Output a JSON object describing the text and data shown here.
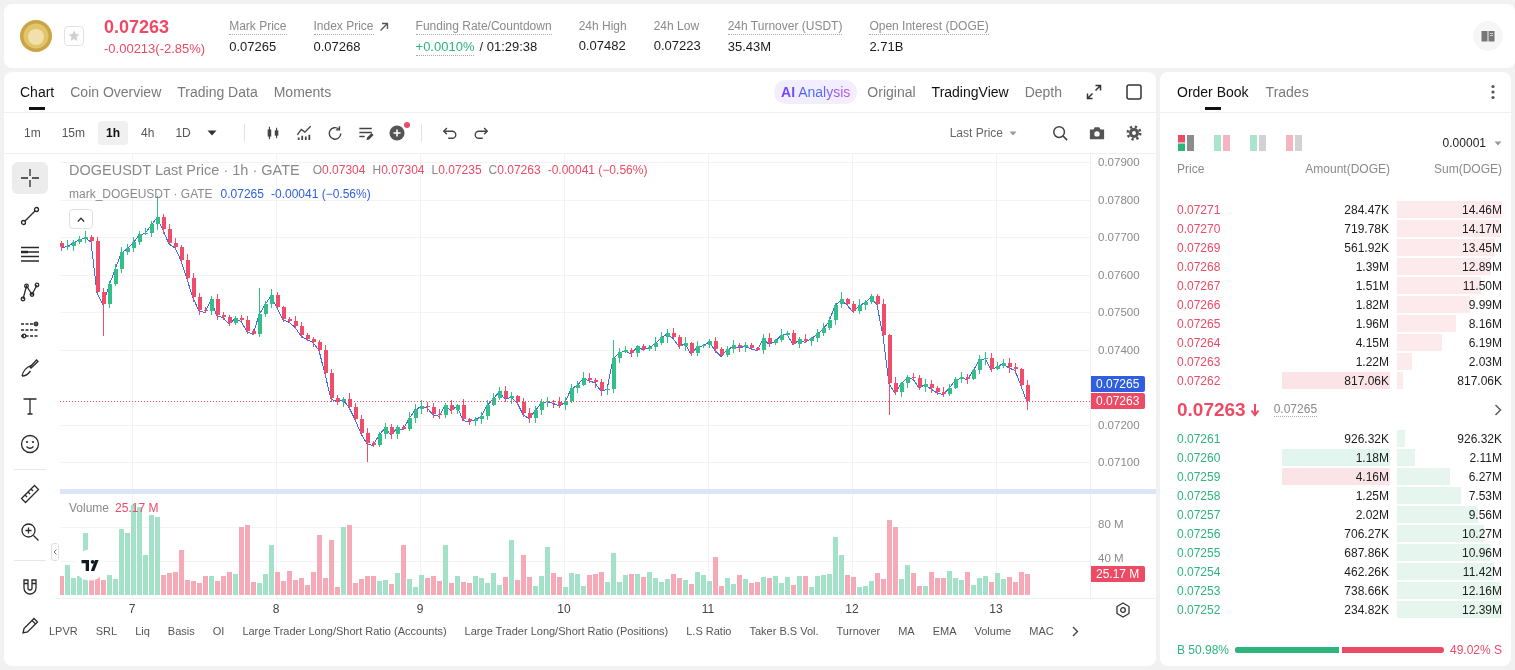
{
  "ticker": {
    "favorite": false,
    "price": "0.07263",
    "change": "-0.00213(-2.85%)",
    "rising": false
  },
  "stats": [
    {
      "kind": "plain",
      "label": "Mark Price",
      "value": "0.07265",
      "has_tooltip": true
    },
    {
      "kind": "link",
      "label": "Index Price",
      "value": "0.07268",
      "has_tooltip": true
    },
    {
      "kind": "funding",
      "label": "Funding Rate/Countdown",
      "value": "+0.0010%",
      "rising": true,
      "countdown": "/ 01:29:38",
      "has_tooltip": true
    },
    {
      "kind": "plain",
      "label": "24h High",
      "value": "0.07482",
      "has_tooltip": false
    },
    {
      "kind": "plain",
      "label": "24h Low",
      "value": "0.07223",
      "has_tooltip": false
    },
    {
      "kind": "plain",
      "label": "24h Turnover (USDT)",
      "value": "35.43M",
      "has_tooltip": true
    },
    {
      "kind": "plain",
      "label": "Open Interest (DOGE)",
      "value": "2.71B",
      "has_tooltip": true
    }
  ],
  "chart_tabs": [
    {
      "label": "Chart",
      "selected": true
    },
    {
      "label": "Coin Overview",
      "selected": false
    },
    {
      "label": "Trading Data",
      "selected": false
    },
    {
      "label": "Moments",
      "selected": false
    }
  ],
  "view_modes": [
    {
      "kind": "ai",
      "label": "**AI** Analysis",
      "selected": false
    },
    {
      "kind": "mode",
      "label": "Original",
      "selected": false
    },
    {
      "kind": "mode",
      "label": "TradingView",
      "selected": true
    },
    {
      "kind": "mode",
      "label": "Depth",
      "selected": false
    }
  ],
  "intervals": [
    {
      "label": "1m",
      "selected": false
    },
    {
      "label": "15m",
      "selected": false
    },
    {
      "label": "1h",
      "selected": true
    },
    {
      "label": "4h",
      "selected": false
    },
    {
      "label": "1D",
      "selected": false
    }
  ],
  "price_source": "Last Price",
  "drawing_tools": [
    {
      "selected": true
    },
    {
      "selected": false
    },
    {
      "selected": false
    },
    {
      "selected": false
    },
    {
      "selected": false
    },
    {
      "selected": false
    },
    {
      "selected": false
    },
    {
      "selected": false
    },
    {
      "selected": false
    },
    {
      "selected": false
    },
    {
      "selected": false
    },
    {
      "selected": false
    }
  ],
  "legend": {
    "title": "DOGEUSDT Last Price · 1h · GATE",
    "ohlc": [
      {
        "key": "O",
        "value": "0.07304"
      },
      {
        "key": "H",
        "value": "0.07304"
      },
      {
        "key": "L",
        "value": "0.07235"
      },
      {
        "key": "C",
        "value": "0.07263"
      }
    ],
    "change": "-0.00041 (−0.56%)",
    "rising": false
  },
  "mark_legend": {
    "title": "mark_DOGEUSDT · GATE",
    "value": "0.07265",
    "change": "-0.00041 (−0.56%)"
  },
  "price_axis": {
    "ticks": [
      "0.07900",
      "0.07800",
      "0.07700",
      "0.07600",
      "0.07500",
      "0.07400",
      "0.07200",
      "0.07100"
    ],
    "mark_label": "0.07265",
    "last_label": "0.07263"
  },
  "volume": {
    "title": "Volume",
    "value": "25.17 M",
    "ticks": [
      "80 M",
      "40 M"
    ],
    "last_label": "25.17 M"
  },
  "time_axis": [
    "7",
    "8",
    "9",
    "10",
    "11",
    "12",
    "13"
  ],
  "indicators": [
    "LPVR",
    "SRL",
    "Liq",
    "Basis",
    "OI",
    "Large Trader Long/Short Ratio (Accounts)",
    "Large Trader Long/Short Ratio (Positions)",
    "L.S Ratio",
    "Taker B.S Vol.",
    "Turnover",
    "MA",
    "EMA",
    "Volume",
    "MAC"
  ],
  "order_book": {
    "tabs": [
      {
        "label": "Order Book",
        "selected": true
      },
      {
        "label": "Trades",
        "selected": false
      }
    ],
    "layouts": [
      {
        "selected": true
      },
      {
        "selected": false
      },
      {
        "selected": false
      },
      {
        "selected": false
      }
    ],
    "precision": "0.00001",
    "columns": [
      "Price",
      "Amount(DOGE)",
      "Sum(DOGE)"
    ],
    "asks": [
      {
        "price": "0.07271",
        "amount": "284.47K",
        "sum": "14.46M"
      },
      {
        "price": "0.07270",
        "amount": "719.78K",
        "sum": "14.17M"
      },
      {
        "price": "0.07269",
        "amount": "561.92K",
        "sum": "13.45M"
      },
      {
        "price": "0.07268",
        "amount": "1.39M",
        "sum": "12.89M"
      },
      {
        "price": "0.07267",
        "amount": "1.51M",
        "sum": "11.50M"
      },
      {
        "price": "0.07266",
        "amount": "1.82M",
        "sum": "9.99M"
      },
      {
        "price": "0.07265",
        "amount": "1.96M",
        "sum": "8.16M"
      },
      {
        "price": "0.07264",
        "amount": "4.15M",
        "sum": "6.19M"
      },
      {
        "price": "0.07263",
        "amount": "1.22M",
        "sum": "2.03M"
      },
      {
        "price": "0.07262",
        "amount": "817.06K",
        "sum": "817.06K",
        "sell_flash": true
      }
    ],
    "mid": {
      "price": "0.07263",
      "rising": false,
      "mark": "0.07265"
    },
    "bids": [
      {
        "price": "0.07261",
        "amount": "926.32K",
        "sum": "926.32K"
      },
      {
        "price": "0.07260",
        "amount": "1.18M",
        "sum": "2.11M",
        "buy_flash": true
      },
      {
        "price": "0.07259",
        "amount": "4.16M",
        "sum": "6.27M",
        "sell_flash": true
      },
      {
        "price": "0.07258",
        "amount": "1.25M",
        "sum": "7.53M"
      },
      {
        "price": "0.07257",
        "amount": "2.02M",
        "sum": "9.56M"
      },
      {
        "price": "0.07256",
        "amount": "706.27K",
        "sum": "10.27M"
      },
      {
        "price": "0.07255",
        "amount": "687.86K",
        "sum": "10.96M"
      },
      {
        "price": "0.07254",
        "amount": "462.26K",
        "sum": "11.42M"
      },
      {
        "price": "0.07253",
        "amount": "738.66K",
        "sum": "12.16M"
      },
      {
        "price": "0.07252",
        "amount": "234.82K",
        "sum": "12.39M"
      }
    ],
    "ratio": {
      "buy": "B 50.98%",
      "sell": "49.02% S",
      "level": 0.5098
    }
  }
}
